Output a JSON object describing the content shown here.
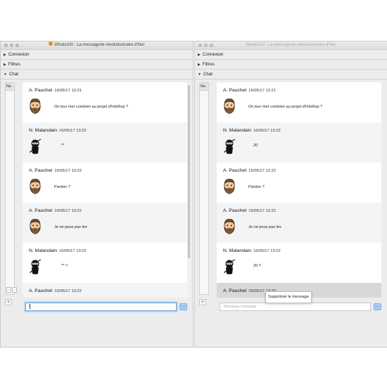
{
  "window_title": "WhatsASI : La messagerie révolutionnaire d'hier",
  "sections": {
    "connexion": "Connexion",
    "filtres": "Filtres",
    "chat": "Chat"
  },
  "sidebar_tab": "No",
  "left": {
    "messages": [
      {
        "author": "A. Pauchet",
        "time": "16/05/17 13:21",
        "text": "On leur met combien au projet d'InfoRep ?",
        "avatar": "bearded-man-avatar"
      },
      {
        "author": "N. Malandain",
        "time": "16/05/17 13:22",
        "text": "**",
        "avatar": "ninja-avatar"
      },
      {
        "author": "A. Pauchet",
        "time": "16/05/17 13:22",
        "text": "Pardon ?",
        "avatar": "bearded-man-avatar"
      },
      {
        "author": "A. Pauchet",
        "time": "16/05/17 13:22",
        "text": "Je ne peux pas lire",
        "avatar": "bearded-man-avatar"
      },
      {
        "author": "N. Malandain",
        "time": "16/05/17 13:22",
        "text": "** !!",
        "avatar": "ninja-avatar"
      },
      {
        "author": "A. Pauchet",
        "time": "16/05/17 13:22",
        "text": "",
        "avatar": "bearded-man-avatar"
      }
    ],
    "input_value": "",
    "send_label": "..."
  },
  "right": {
    "messages": [
      {
        "author": "A. Pauchet",
        "time": "16/05/17 13:21",
        "text": "On leur met combien au projet d'InfoRep ?",
        "avatar": "bearded-man-avatar"
      },
      {
        "author": "N. Malandain",
        "time": "16/05/17 13:22",
        "text": "20",
        "avatar": "ninja-avatar"
      },
      {
        "author": "A. Pauchet",
        "time": "16/05/17 13:22",
        "text": "Pardon ?",
        "avatar": "bearded-man-avatar"
      },
      {
        "author": "A. Pauchet",
        "time": "16/05/17 13:22",
        "text": "Je ne peux pas lire",
        "avatar": "bearded-man-avatar"
      },
      {
        "author": "N. Malandain",
        "time": "16/05/17 13:22",
        "text": "20 !!",
        "avatar": "ninja-avatar"
      },
      {
        "author": "A. Pauchet",
        "time": "16/05/17 13:22",
        "text": "",
        "avatar": "bearded-man-avatar"
      }
    ],
    "input_placeholder": "Nouveau message",
    "send_label": "...",
    "context_menu_item": "Supprimer le message"
  },
  "colors": {
    "accent": "#a6cdf0",
    "focus_ring": "#6fa7e0",
    "selected_row": "#d8d8d8",
    "title_icon": "#f08a24"
  }
}
